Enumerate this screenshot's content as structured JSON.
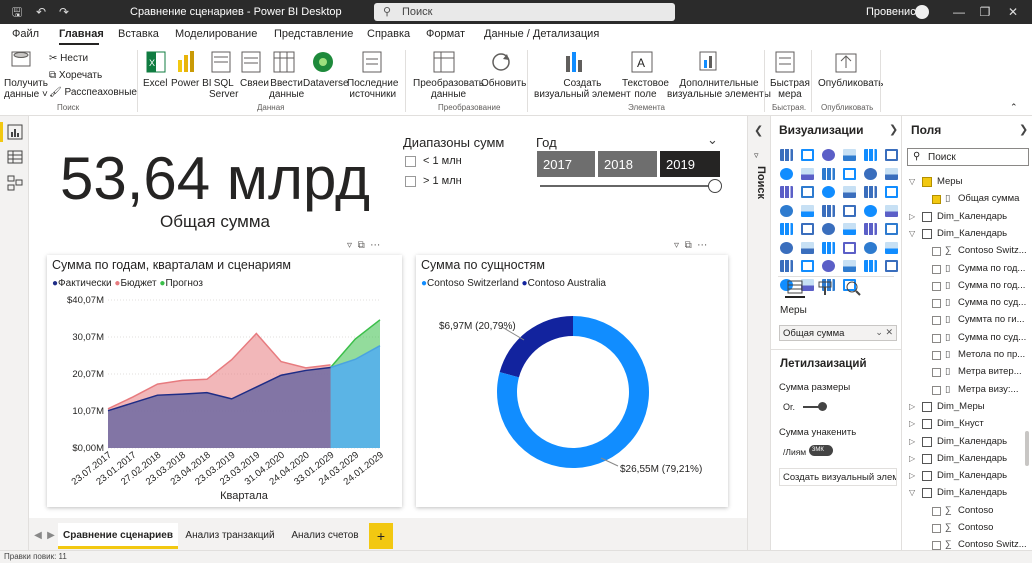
{
  "window": {
    "title": "Сравнение сценариев - Power BI Desktop",
    "search_placeholder": "Поиск",
    "user": "Провенис:"
  },
  "menu": [
    "Файл",
    "Главная",
    "Вставка",
    "Моделирование",
    "Представление",
    "Справка",
    "Формат",
    "Данные / Детализация"
  ],
  "ribbon": {
    "get_data": "Получить\nданные",
    "paste": "Вставить",
    "cut": "Нести",
    "copy": "Хоречать",
    "format_painter": "Расспеаховные",
    "excel": "Excel",
    "powerbi": "Power BI",
    "sql": "SQL\nServer",
    "links": "Свяеи",
    "enter_data": "Ввести\nданные",
    "dataverse": "Dataverse",
    "recent": "Последние\nисточники",
    "transform": "Преобразовать\nданные",
    "refresh": "Обновить",
    "new_visual": "Создать\nвизуальный элемент",
    "textbox": "Текстовое\nполе",
    "more_visuals": "Дополнительные\nвизуальные элементы",
    "quick_measure": "Быстрая\nмера",
    "publish": "Опубликовать",
    "groups": [
      "Поиск",
      "Данная",
      "Преобразование",
      "Элемента",
      "Быстрая.",
      "Опубликовать"
    ]
  },
  "kpi": {
    "value": "53,64 млрд",
    "label": "Общая сумма"
  },
  "slicer_ranges": {
    "title": "Диапазоны сумм",
    "options": [
      "< 1 млн",
      "> 1 млн"
    ]
  },
  "slicer_year": {
    "title": "Год",
    "years": [
      "2017",
      "2018",
      "2019"
    ],
    "selected": "2019"
  },
  "area_chart": {
    "title": "Сумма по годам, кварталам и сценариям",
    "legend": [
      "Фактически",
      "Бюджет",
      "Прогноз"
    ],
    "xlabel": "Квартала",
    "yticks": [
      "$40,07M",
      "30,07M",
      "20,07M",
      "10,07M",
      "$0,00M"
    ]
  },
  "donut_chart": {
    "title": "Сумма по сущностям",
    "legend": [
      "Contoso Switzerland",
      "Contoso Australia"
    ],
    "label_small": "$6,97M (20,79%)",
    "label_large": "$26,55M (79,21%)"
  },
  "chart_data": [
    {
      "type": "area",
      "title": "Сумма по годам, кварталам и сценариям",
      "xlabel": "Квартала",
      "ylabel": "",
      "ylim": [
        0,
        40.07
      ],
      "categories": [
        "23.07.2017",
        "23.01.2017",
        "27.02.2018",
        "23.03.2018",
        "23.04.2018",
        "23.03.2019",
        "23.03.2019",
        "31.04.2020",
        "24.04.2020",
        "33.01.2029",
        "24.03.2029",
        "24.01.2029"
      ],
      "series": [
        {
          "name": "Фактически",
          "values": [
            10.1,
            12.2,
            14.3,
            14.6,
            15.0,
            13.3,
            16.5,
            19.7,
            21.0,
            21.8,
            null,
            null
          ]
        },
        {
          "name": "Бюджет",
          "values": [
            10.6,
            13.8,
            17.3,
            18.3,
            18.6,
            23.9,
            31.0,
            23.4,
            21.7,
            22.5,
            null,
            null
          ]
        },
        {
          "name": "Прогноз",
          "values": [
            null,
            null,
            null,
            null,
            null,
            null,
            null,
            null,
            null,
            21.8,
            24.0,
            27.7
          ]
        },
        {
          "name": "Прогноз",
          "values": [
            null,
            null,
            null,
            null,
            null,
            null,
            null,
            null,
            null,
            21.8,
            29.5,
            34.7
          ]
        }
      ]
    },
    {
      "type": "pie",
      "title": "Сумма по сущностям",
      "categories": [
        "Contoso Switzerland",
        "Contoso Australia"
      ],
      "values": [
        26.55,
        6.97
      ],
      "percent": [
        79.21,
        20.79
      ]
    }
  ],
  "pages": [
    "Сравнение сценариев",
    "Анализ транзакций",
    "Анализ счетов"
  ],
  "add_page": "+",
  "status": "Правки повик: 11",
  "search_strip": "Поиск",
  "viz_pane": {
    "title": "Визуализации",
    "well_label": "Меры",
    "well_value": "Общая сумма",
    "section": "Летилзаизаций",
    "opt1": "Сумма размеры",
    "opt1_value": "Or.",
    "opt2": "Сумма унакенить",
    "opt2_value": "/Лиям",
    "toggle": "3МК",
    "create": "Создать визуальный элем..."
  },
  "fields_pane": {
    "title": "Поля",
    "search": "Поиск",
    "items": [
      {
        "label": "Меры",
        "kind": "table",
        "open": true
      },
      {
        "label": "Общая сумма",
        "kind": "measure",
        "checked": true
      },
      {
        "label": "Dim_Календарь",
        "kind": "table",
        "open": false
      },
      {
        "label": "Dim_Календарь",
        "kind": "table",
        "open": true
      },
      {
        "label": "Contoso Switz...",
        "kind": "sigma",
        "checked": false
      },
      {
        "label": "Сумма по год...",
        "kind": "field",
        "checked": false
      },
      {
        "label": "Сумма по год...",
        "kind": "field",
        "checked": false
      },
      {
        "label": "Сумма по суд...",
        "kind": "field",
        "checked": false
      },
      {
        "label": "Суммта по ги...",
        "kind": "field",
        "checked": false
      },
      {
        "label": "Сумма по суд...",
        "kind": "field",
        "checked": false
      },
      {
        "label": "Метола по пр...",
        "kind": "field",
        "checked": false
      },
      {
        "label": "Метра витер...",
        "kind": "field",
        "checked": false
      },
      {
        "label": "Метра визу:...",
        "kind": "field",
        "checked": false
      },
      {
        "label": "Dim_Меры",
        "kind": "table",
        "open": false
      },
      {
        "label": "Dim_Кнуст",
        "kind": "table",
        "open": false
      },
      {
        "label": "Dim_Календарь",
        "kind": "table",
        "open": false
      },
      {
        "label": "Dim_Календарь",
        "kind": "table",
        "open": false
      },
      {
        "label": "Dim_Календарь",
        "kind": "table",
        "open": false
      },
      {
        "label": "Dim_Календарь",
        "kind": "table",
        "open": true
      },
      {
        "label": "Contoso",
        "kind": "sigma",
        "checked": false
      },
      {
        "label": "Contoso",
        "kind": "sigma",
        "checked": false
      },
      {
        "label": "Contoso Switz...",
        "kind": "sigma",
        "checked": false
      }
    ]
  },
  "colors": {
    "actual": "#1f2d86",
    "budget": "#e77b7f",
    "forecast": "#3bbf4a",
    "donut_large": "#118dff",
    "donut_small": "#12239e",
    "accent": "#f2c811"
  }
}
